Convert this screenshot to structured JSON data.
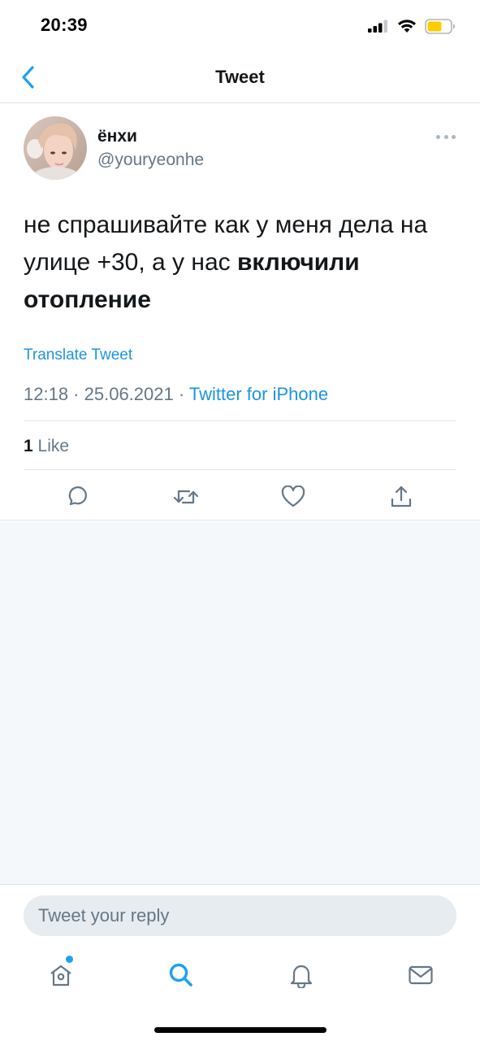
{
  "status_bar": {
    "time": "20:39",
    "icons": [
      "cellular-signal-icon",
      "wifi-icon",
      "battery-icon"
    ],
    "battery_color": "#ffcc00"
  },
  "nav": {
    "title": "Tweet",
    "back_icon": "chevron-left-icon",
    "accent": "#1da1f2"
  },
  "tweet": {
    "display_name": "ёнхи",
    "handle": "@youryeonhe",
    "text_regular": "не спрашивайте как у меня дела на улице +30, а у нас ",
    "text_bold": "включили отопление",
    "translate_label": "Translate Tweet",
    "time": "12:18",
    "date": "25.06.2021",
    "separator": " · ",
    "source": "Twitter for iPhone",
    "like_count": "1",
    "like_label": "Like",
    "actions": [
      "reply-icon",
      "retweet-icon",
      "like-icon",
      "share-icon"
    ]
  },
  "reply": {
    "placeholder": "Tweet your reply"
  },
  "tab_bar": {
    "tabs": [
      "home-icon",
      "search-icon",
      "notifications-icon",
      "messages-icon"
    ],
    "active_color": "#1da1f2",
    "inactive_color": "#657786"
  }
}
